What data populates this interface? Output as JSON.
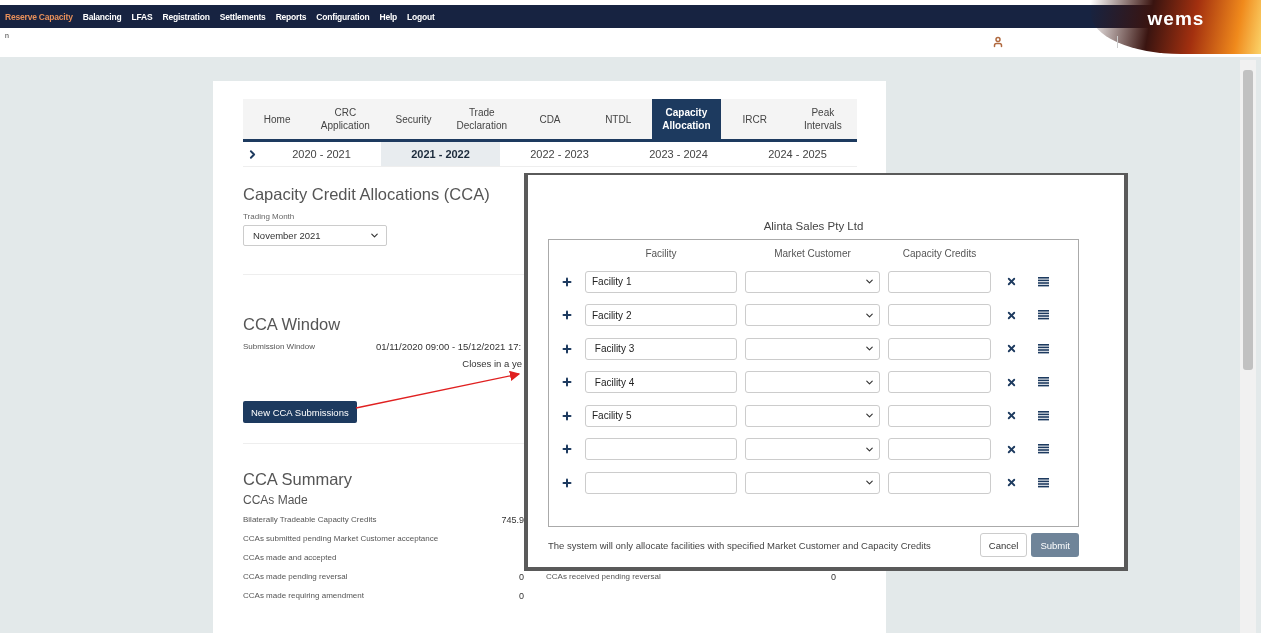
{
  "top_menu": [
    {
      "label": "Reserve Capacity",
      "selected": true
    },
    {
      "label": "Balancing",
      "selected": false
    },
    {
      "label": "LFAS",
      "selected": false
    },
    {
      "label": "Registration",
      "selected": false
    },
    {
      "label": "Settlements",
      "selected": false
    },
    {
      "label": "Reports",
      "selected": false
    },
    {
      "label": "Configuration",
      "selected": false
    },
    {
      "label": "Help",
      "selected": false
    },
    {
      "label": "Logout",
      "selected": false
    }
  ],
  "logo": {
    "text": "wems"
  },
  "sub_bar": {
    "fragment": "n"
  },
  "tabs": [
    {
      "label": "Home",
      "selected": false
    },
    {
      "label": "CRC Application",
      "selected": false
    },
    {
      "label": "Security",
      "selected": false
    },
    {
      "label": "Trade Declaration",
      "selected": false
    },
    {
      "label": "CDA",
      "selected": false
    },
    {
      "label": "NTDL",
      "selected": false
    },
    {
      "label": "Capacity Allocation",
      "selected": true
    },
    {
      "label": "IRCR",
      "selected": false
    },
    {
      "label": "Peak Intervals",
      "selected": false
    }
  ],
  "years": [
    {
      "label": "2020 - 2021",
      "selected": false
    },
    {
      "label": "2021 - 2022",
      "selected": true
    },
    {
      "label": "2022 - 2023",
      "selected": false
    },
    {
      "label": "2023 - 2024",
      "selected": false
    },
    {
      "label": "2024 - 2025",
      "selected": false
    }
  ],
  "page_title": "Capacity Credit Allocations (CCA)",
  "trading_month": {
    "label": "Trading Month",
    "value": "November 2021"
  },
  "cca_window": {
    "title": "CCA Window",
    "label": "Submission Window",
    "value": "01/11/2020 09:00 - 15/12/2021 17:",
    "note": "Closes in a ye",
    "button": "New CCA Submissions"
  },
  "summary": {
    "title": "CCA Summary",
    "subtitle": "CCAs Made",
    "rows": [
      {
        "label": "Bilaterally Tradeable Capacity Credits",
        "value": "745.9"
      },
      {
        "label": "CCAs submitted pending Market Customer acceptance"
      },
      {
        "label": "CCAs made and accepted"
      },
      {
        "label": "CCAs made pending reversal",
        "value": "0",
        "other_label": "CCAs received pending reversal",
        "other_value": "0"
      },
      {
        "label": "CCAs made requiring amendment",
        "value": "0"
      }
    ]
  },
  "modal": {
    "title": "Alinta Sales Pty Ltd",
    "columns": [
      "Facility",
      "Market Customer",
      "Capacity Credits"
    ],
    "rows": [
      {
        "facility": "Facility 1"
      },
      {
        "facility": "Facility 2"
      },
      {
        "facility": " Facility 3"
      },
      {
        "facility": " Facility 4"
      },
      {
        "facility": "Facility 5"
      },
      {},
      {}
    ],
    "note": "The system will only allocate facilities with specified Market Customer and Capacity Credits",
    "buttons": [
      {
        "label": "Cancel",
        "kind": "secondary"
      },
      {
        "label": "Submit",
        "kind": "primary",
        "disabled": true
      }
    ]
  }
}
